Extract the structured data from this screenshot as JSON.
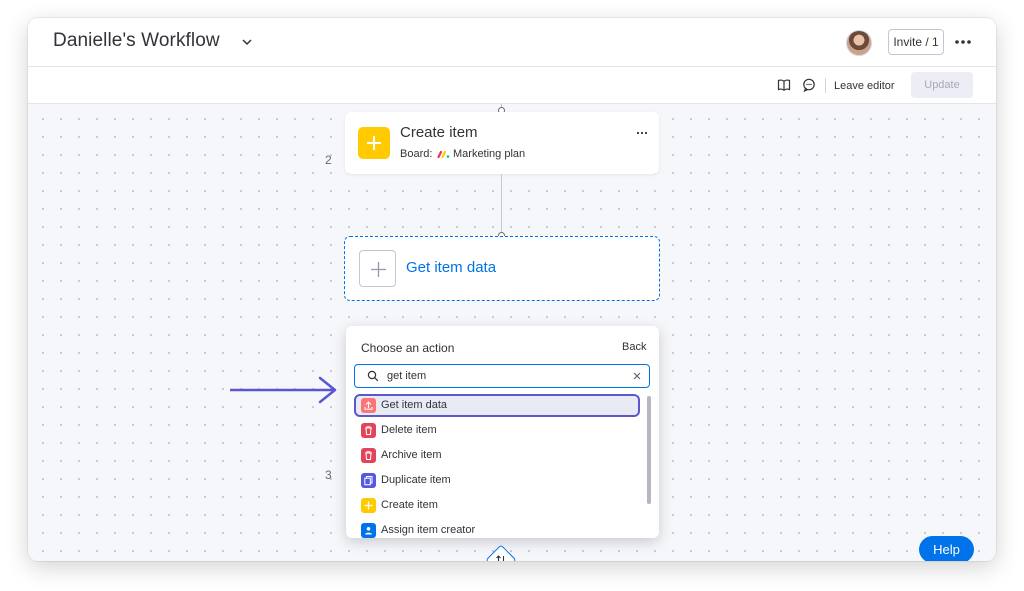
{
  "header": {
    "title": "Danielle's Workflow",
    "invite_label": "Invite / 1"
  },
  "toolbar": {
    "leave_label": "Leave editor",
    "update_label": "Update"
  },
  "steps": {
    "create": {
      "number": "2",
      "title": "Create item",
      "board_label": "Board:",
      "board_name": "Marketing plan"
    },
    "get": {
      "title": "Get item data"
    },
    "next_number": "3"
  },
  "action_picker": {
    "title": "Choose an action",
    "back_label": "Back",
    "search_value": "get item",
    "items": [
      {
        "label": "Get item data",
        "icon": "export-icon",
        "color": "#ff7575",
        "highlighted": true
      },
      {
        "label": "Delete item",
        "icon": "trash-icon",
        "color": "#e2445c"
      },
      {
        "label": "Archive item",
        "icon": "archive-icon",
        "color": "#e2445c"
      },
      {
        "label": "Duplicate item",
        "icon": "duplicate-icon",
        "color": "#5559df"
      },
      {
        "label": "Create item",
        "icon": "plus-icon",
        "color": "#ffcb00"
      },
      {
        "label": "Assign item creator",
        "icon": "person-icon",
        "color": "#0073ea"
      }
    ]
  },
  "help_label": "Help",
  "colors": {
    "primary": "#0073ea",
    "highlight": "#5a57cf",
    "create": "#ffcb00"
  }
}
